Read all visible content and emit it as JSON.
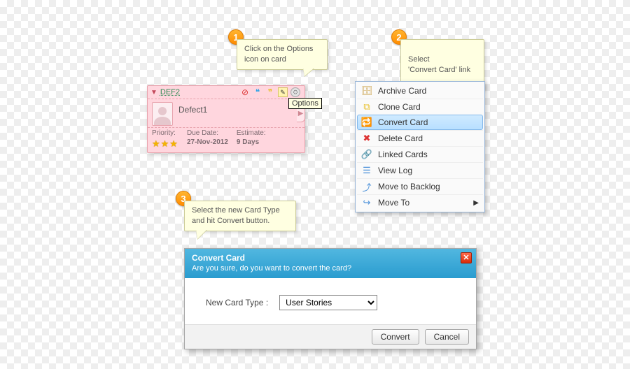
{
  "steps": {
    "s1": "Click on the Options icon on card",
    "s2": "Select\n'Convert Card' link",
    "s3": "Select the new Card Type and hit Convert button."
  },
  "card": {
    "id": "DEF2",
    "title": "Defect1",
    "priority_label": "Priority:",
    "due_label": "Due Date:",
    "due_value": "27-Nov-2012",
    "est_label": "Estimate:",
    "est_value": "9 Days",
    "options_tooltip": "Options"
  },
  "menu": {
    "archive": "Archive Card",
    "clone": "Clone Card",
    "convert": "Convert Card",
    "delete": "Delete Card",
    "linked": "Linked Cards",
    "viewlog": "View Log",
    "backlog": "Move to Backlog",
    "moveto": "Move To"
  },
  "dialog": {
    "title": "Convert Card",
    "subtitle": "Are you sure, do you want to convert the card?",
    "field_label": "New Card Type  :",
    "selected_option": "User Stories",
    "convert_btn": "Convert",
    "cancel_btn": "Cancel"
  }
}
